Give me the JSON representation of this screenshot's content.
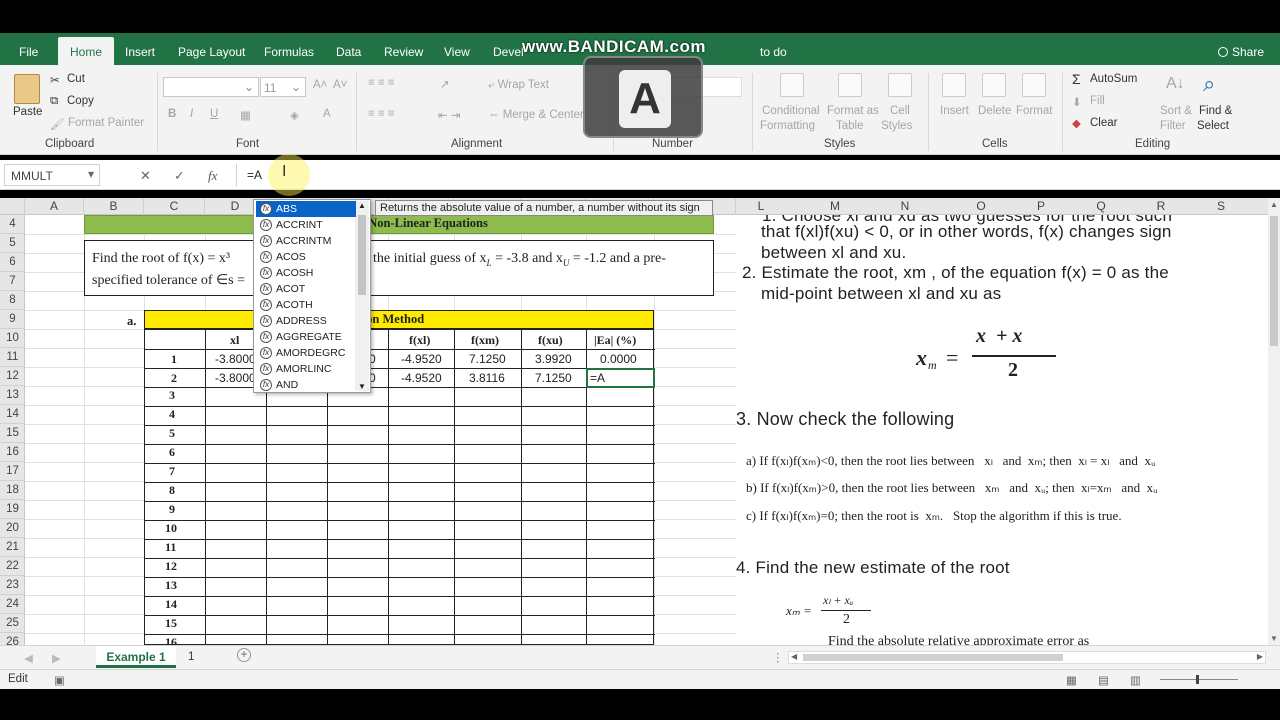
{
  "ribbon_tabs": [
    "File",
    "Home",
    "Insert",
    "Page Layout",
    "Formulas",
    "Data",
    "Review",
    "View",
    "Devel",
    "to do"
  ],
  "share": "Share",
  "watermark": {
    "text": "www.BANDICAM.com",
    "badge": "A"
  },
  "clipboard": {
    "paste": "Paste",
    "cut": "Cut",
    "copy": "Copy",
    "format_painter": "Format Painter",
    "label": "Clipboard"
  },
  "font": {
    "size": "11",
    "label": "Font",
    "bold": "B",
    "italic": "I",
    "underline": "U"
  },
  "alignment": {
    "wrap": "Wrap Text",
    "merge": "Merge & Center",
    "label": "Alignment"
  },
  "number": {
    "label": "Number"
  },
  "styles": {
    "conditional": "Conditional",
    "formatting": "Formatting",
    "format_as": "Format as",
    "table": "Table",
    "cell": "Cell",
    "cell_styles": "Styles",
    "label": "Styles"
  },
  "cells": {
    "insert": "Insert",
    "delete": "Delete",
    "format": "Format",
    "label": "Cells"
  },
  "editing": {
    "autosum": "AutoSum",
    "fill": "Fill",
    "clear": "Clear",
    "sort1": "Sort &",
    "sort2": "Filter",
    "find1": "Find &",
    "find2": "Select",
    "label": "Editing"
  },
  "formula_bar": {
    "name_box": "MMULT",
    "cancel": "✕",
    "enter": "✓",
    "fx": "fx",
    "formula": "=A"
  },
  "columns": [
    "A",
    "B",
    "C",
    "D",
    "E",
    "F",
    "G",
    "H",
    "I",
    "J",
    "K",
    "L",
    "M",
    "N",
    "O",
    "P",
    "Q",
    "R",
    "S"
  ],
  "rows": [
    "4",
    "5",
    "6",
    "7",
    "8",
    "9",
    "10",
    "11",
    "12",
    "13",
    "14",
    "15",
    "16",
    "17",
    "18",
    "19",
    "20",
    "21",
    "22",
    "23",
    "24",
    "25",
    "26"
  ],
  "sheet": {
    "header_banner": "and Non-Linear Equations",
    "problem_line1_a": "Find the root of f(x) = x³",
    "problem_line1_b": "the initial guess of x",
    "problem_line1_c": "L",
    "problem_line1_d": " = -3.8 and x",
    "problem_line1_e": "U",
    "problem_line1_f": " = -1.2 and a pre-",
    "problem_line2": "specified tolerance of ∈s =",
    "part_label": "a.",
    "table_title": "ction Method",
    "table_headers": [
      "xl",
      "f(xl)",
      "f(xm)",
      "f(xu)",
      "|Ea| (%)"
    ],
    "row1": {
      "n": "1",
      "xl": "-3.8000",
      "xm": "0",
      "fxl": "-4.9520",
      "fxm": "7.1250",
      "fxu": "3.9920",
      "ea": "0.0000"
    },
    "row2": {
      "n": "2",
      "xl": "-3.8000",
      "xm": "0",
      "fxl": "-4.9520",
      "fxm": "3.8116",
      "fxu": "7.1250",
      "ea": "=A"
    },
    "iterations": [
      "3",
      "4",
      "5",
      "6",
      "7",
      "8",
      "9",
      "10",
      "11",
      "12",
      "13",
      "14",
      "15",
      "16"
    ]
  },
  "autocomplete": {
    "items": [
      "ABS",
      "ACCRINT",
      "ACCRINTM",
      "ACOS",
      "ACOSH",
      "ACOT",
      "ACOTH",
      "ADDRESS",
      "AGGREGATE",
      "AMORDEGRC",
      "AMORLINC",
      "AND"
    ],
    "tooltip": "Returns the absolute value of a number, a number without its sign"
  },
  "notes": {
    "l1": "1. Choose   xl and xu as two guesses for the root such",
    "l2": "that f(xl)f(xu) < 0, or in other words, f(x) changes sign",
    "l3": "between xl and xu.",
    "l4": "2.  Estimate the root, xm , of the equation f(x) = 0 as the",
    "l5": "mid-point between  xl and xu as",
    "eq1_lhs": "x",
    "eq1_sub": "m",
    "eq1_num": "x",
    "eq1_num2": "+ x",
    "eq1_den": "2",
    "l6": "3. Now check the following",
    "ca": "a)  If  f(x",
    "ca2": ")f(x",
    "ca3": ")<0, then the root lies between",
    "ca4": "and",
    "ca5": "; then",
    "ca6": "and",
    "cb3": ")>0, then the root lies between",
    "cb4": "and",
    "cb5": "; then",
    "cb6": "and",
    "cc": "c)  If",
    "cc3": ")=0; then the root is",
    "cc4": "Stop the algorithm if this is true.",
    "cb": "b)  If",
    "l7": "4. Find the new estimate of the root",
    "l8": "Find the absolute relative approximate error as"
  },
  "sheet_tabs": {
    "active": "Example 1",
    "other": "1",
    "add": "+"
  },
  "status": {
    "mode": "Edit"
  }
}
